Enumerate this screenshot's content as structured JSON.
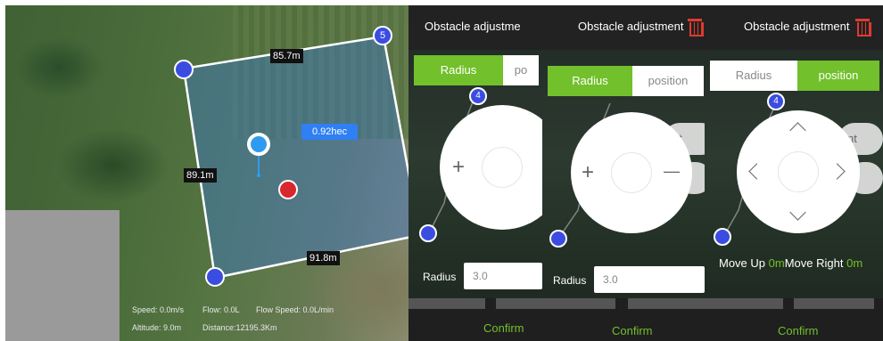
{
  "map": {
    "edge_top": "85.7m",
    "edge_left": "89.1m",
    "edge_bottom": "91.8m",
    "area": "0.92hec",
    "vertex_number": "5",
    "stats": {
      "speed": "Speed\u0000: 0.0m/s",
      "flow": "Flow\u0000: 0.0L",
      "flow_speed": "Flow Speed\u0000: 0.0L/min",
      "altitude": "Altitude\u0000: 9.0m",
      "distance": "Distance:12195.3Km"
    }
  },
  "panel1": {
    "title": "Obstacle adjustme",
    "tab_radius": "Radius",
    "tab_position": "po",
    "plus": "+",
    "radius_label": "Radius",
    "radius_value": "3.0",
    "confirm": "Confirm",
    "vertex": "4"
  },
  "panel2": {
    "title": "Obstacle adjustment",
    "tab_radius": "Radius",
    "tab_position": "position",
    "plus": "+",
    "minus": "—",
    "ghost_button": "nt",
    "radius_label": "Radius",
    "radius_value": "3.0",
    "confirm": "Confirm",
    "vertex": "4"
  },
  "panel3": {
    "title": "Obstacle adjustment",
    "tab_radius": "Radius",
    "tab_position": "position",
    "ghost_button": "nt",
    "move_up_label": "Move Up",
    "move_up_value": "0m",
    "move_right_label": "Move Right",
    "move_right_value": "0m",
    "confirm": "Confirm",
    "vertex": "4"
  },
  "colors": {
    "accent_green": "#72c02c",
    "vertex_blue": "#3b4de0",
    "trash_red": "#e03a2f",
    "area_blue": "#2f7ff5"
  }
}
